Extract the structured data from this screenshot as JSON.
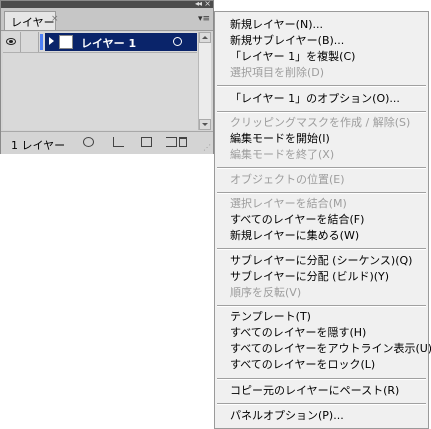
{
  "panel": {
    "tab_label": "レイヤー",
    "tab_close": "×",
    "collapse_glyph": "◂◂",
    "close_glyph": "×",
    "menu_glyph": "▾≡",
    "layer": {
      "name": "レイヤー 1",
      "color": "#4f7ff5",
      "selected_bg": "#0a246a"
    },
    "footer": {
      "count_text": "1 レイヤー"
    }
  },
  "menu": {
    "items": [
      {
        "label": "新規レイヤー(N)...",
        "enabled": true
      },
      {
        "label": "新規サブレイヤー(B)...",
        "enabled": true
      },
      {
        "label": "「レイヤー 1」を複製(C)",
        "enabled": true
      },
      {
        "label": "選択項目を削除(D)",
        "enabled": false
      },
      {
        "label": "「レイヤー 1」のオプション(O)...",
        "enabled": true
      },
      {
        "label": "クリッピングマスクを作成 / 解除(S)",
        "enabled": false
      },
      {
        "label": "編集モードを開始(I)",
        "enabled": true
      },
      {
        "label": "編集モードを終了(X)",
        "enabled": false
      },
      {
        "label": "オブジェクトの位置(E)",
        "enabled": false
      },
      {
        "label": "選択レイヤーを結合(M)",
        "enabled": false
      },
      {
        "label": "すべてのレイヤーを結合(F)",
        "enabled": true
      },
      {
        "label": "新規レイヤーに集める(W)",
        "enabled": true
      },
      {
        "label": "サブレイヤーに分配 (シーケンス)(Q)",
        "enabled": true
      },
      {
        "label": "サブレイヤーに分配 (ビルド)(Y)",
        "enabled": true
      },
      {
        "label": "順序を反転(V)",
        "enabled": false
      },
      {
        "label": "テンプレート(T)",
        "enabled": true
      },
      {
        "label": "すべてのレイヤーを隠す(H)",
        "enabled": true
      },
      {
        "label": "すべてのレイヤーをアウトライン表示(U)",
        "enabled": true
      },
      {
        "label": "すべてのレイヤーをロック(L)",
        "enabled": true
      },
      {
        "label": "コピー元のレイヤーにペースト(R)",
        "enabled": true
      },
      {
        "label": "パネルオプション(P)...",
        "enabled": true
      }
    ]
  }
}
